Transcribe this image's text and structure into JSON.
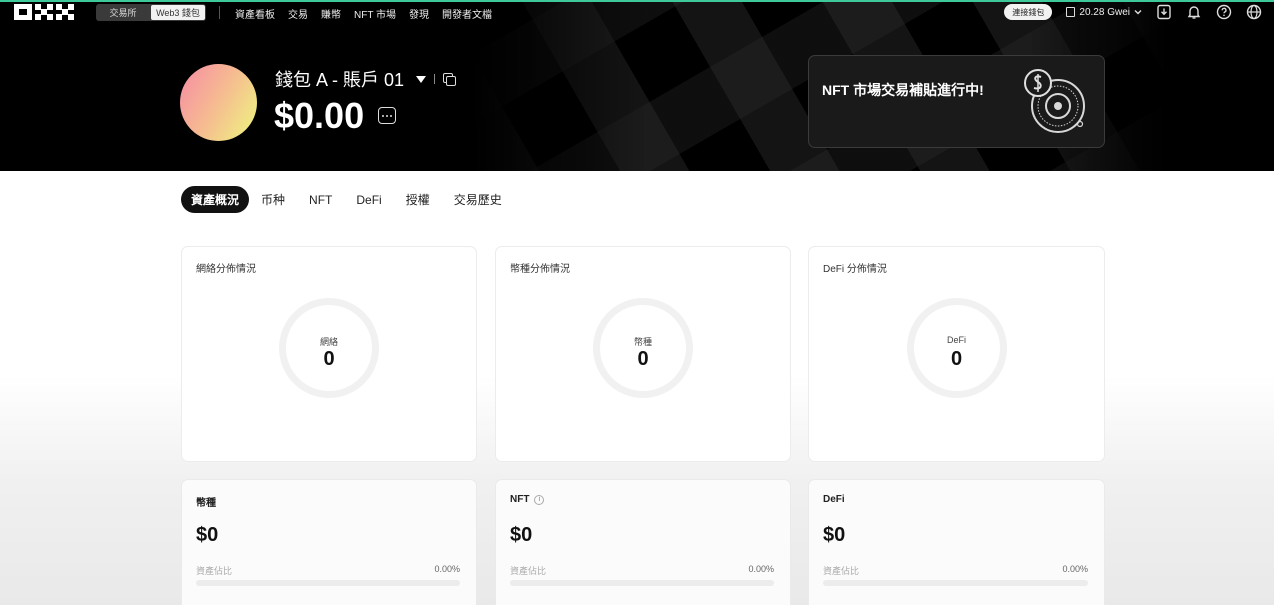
{
  "nav": {
    "mode_tabs": [
      "交易所",
      "Web3 錢包"
    ],
    "links": [
      "資產看板",
      "交易",
      "賺幣",
      "NFT 市場",
      "發現",
      "開發者文檔"
    ],
    "connect_label": "連接錢包",
    "gas": "20.28 Gwei"
  },
  "wallet": {
    "name": "錢包 A - 賬戶 01",
    "balance": "$0.00"
  },
  "promo": {
    "text": "NFT 市場交易補貼進行中!"
  },
  "tabs": [
    "資產概況",
    "币种",
    "NFT",
    "DeFi",
    "授權",
    "交易歷史"
  ],
  "distribution_cards": [
    {
      "title": "網絡分佈情況",
      "ring_label": "網絡",
      "ring_value": "0"
    },
    {
      "title": "幣種分佈情況",
      "ring_label": "幣種",
      "ring_value": "0"
    },
    {
      "title": "DeFi 分佈情況",
      "ring_label": "DeFi",
      "ring_value": "0"
    }
  ],
  "asset_cards": [
    {
      "title": "幣種",
      "value": "$0",
      "label": "資產佔比",
      "percent": "0.00%",
      "share": 0
    },
    {
      "title": "NFT",
      "value": "$0",
      "label": "資產佔比",
      "percent": "0.00%",
      "share": 0
    },
    {
      "title": "DeFi",
      "value": "$0",
      "label": "資產佔比",
      "percent": "0.00%",
      "share": 0
    }
  ],
  "colors": {
    "header_bg": "#000000",
    "accent": "#3ec99a",
    "avatar_gradient": [
      "#f58ba6",
      "#eef77f"
    ]
  }
}
